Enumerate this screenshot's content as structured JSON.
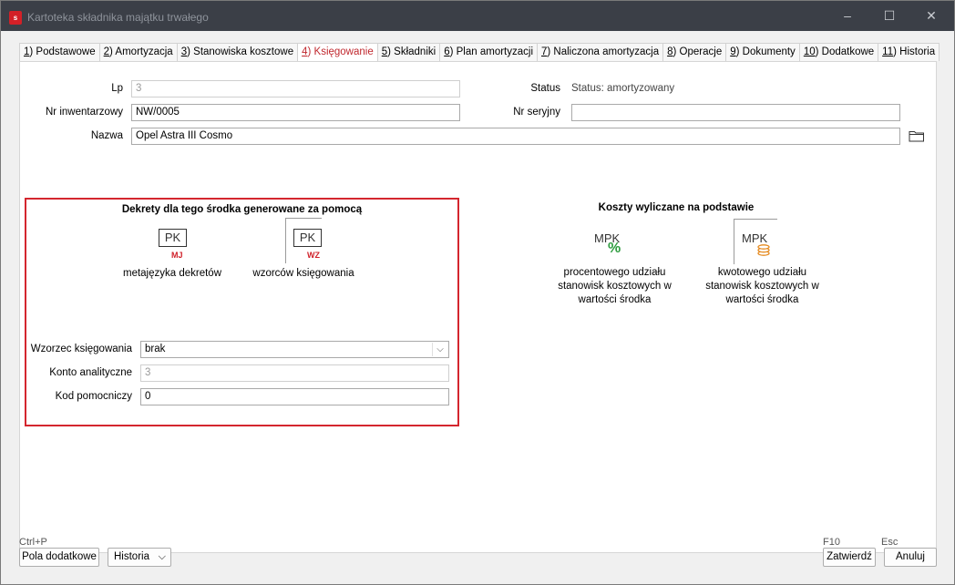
{
  "window": {
    "title": "Kartoteka składnika majątku trwałego",
    "app_icon_label": "s",
    "minimize": "–",
    "maximize": "☐",
    "close": "✕"
  },
  "tabs": [
    {
      "key": "1",
      "label": ") Podstawowe"
    },
    {
      "key": "2",
      "label": ") Amortyzacja"
    },
    {
      "key": "3",
      "label": ") Stanowiska kosztowe"
    },
    {
      "key": "4",
      "label": ") Księgowanie"
    },
    {
      "key": "5",
      "label": ") Składniki"
    },
    {
      "key": "6",
      "label": ") Plan amortyzacji"
    },
    {
      "key": "7",
      "label": ") Naliczona amortyzacja"
    },
    {
      "key": "8",
      "label": ") Operacje"
    },
    {
      "key": "9",
      "label": ") Dokumenty"
    },
    {
      "key": "10",
      "label": ") Dodatkowe"
    },
    {
      "key": "11",
      "label": ") Historia"
    }
  ],
  "form": {
    "lp_label": "Lp",
    "lp_value": "3",
    "status_label": "Status",
    "status_value": "Status: amortyzowany",
    "inv_label": "Nr inwentarzowy",
    "inv_value": "NW/0005",
    "serial_label": "Nr seryjny",
    "serial_value": "",
    "name_label": "Nazwa",
    "name_value": "Opel Astra III Cosmo"
  },
  "decrees": {
    "title": "Dekrety dla tego środka generowane za pomocą",
    "option1_icon_main": "PK",
    "option1_icon_sub": "MJ",
    "option1_label": "metajęzyka dekretów",
    "option2_icon_main": "PK",
    "option2_icon_sub": "WZ",
    "option2_label": "wzorców księgowania",
    "pattern_label": "Wzorzec księgowania",
    "pattern_value": "brak",
    "account_label": "Konto analityczne",
    "account_value": "3",
    "aux_label": "Kod pomocniczy",
    "aux_value": "0"
  },
  "costs": {
    "title": "Koszty wyliczane na podstawie",
    "option1_icon_main": "MPK",
    "option1_icon_sub": "%",
    "option1_line1": "procentowego udziału",
    "option1_line2": "stanowisk kosztowych  w",
    "option1_line3": "wartości środka",
    "option2_icon_main": "MPK",
    "option2_line1": "kwotowego udziału",
    "option2_line2": "stanowisk kosztowych w",
    "option2_line3": "wartości środka"
  },
  "footer": {
    "hint_left": "Ctrl+P",
    "btn_extra": "Pola dodatkowe",
    "btn_history": "Historia",
    "hint_f10": "F10",
    "hint_esc": "Esc",
    "btn_confirm": "Zatwierdź",
    "btn_cancel": "Anuluj"
  },
  "colors": {
    "accent_red": "#d4262e",
    "titlebar": "#3b3f47",
    "mpk_green": "#2e9c3f",
    "mpk_orange": "#e58a1f"
  }
}
